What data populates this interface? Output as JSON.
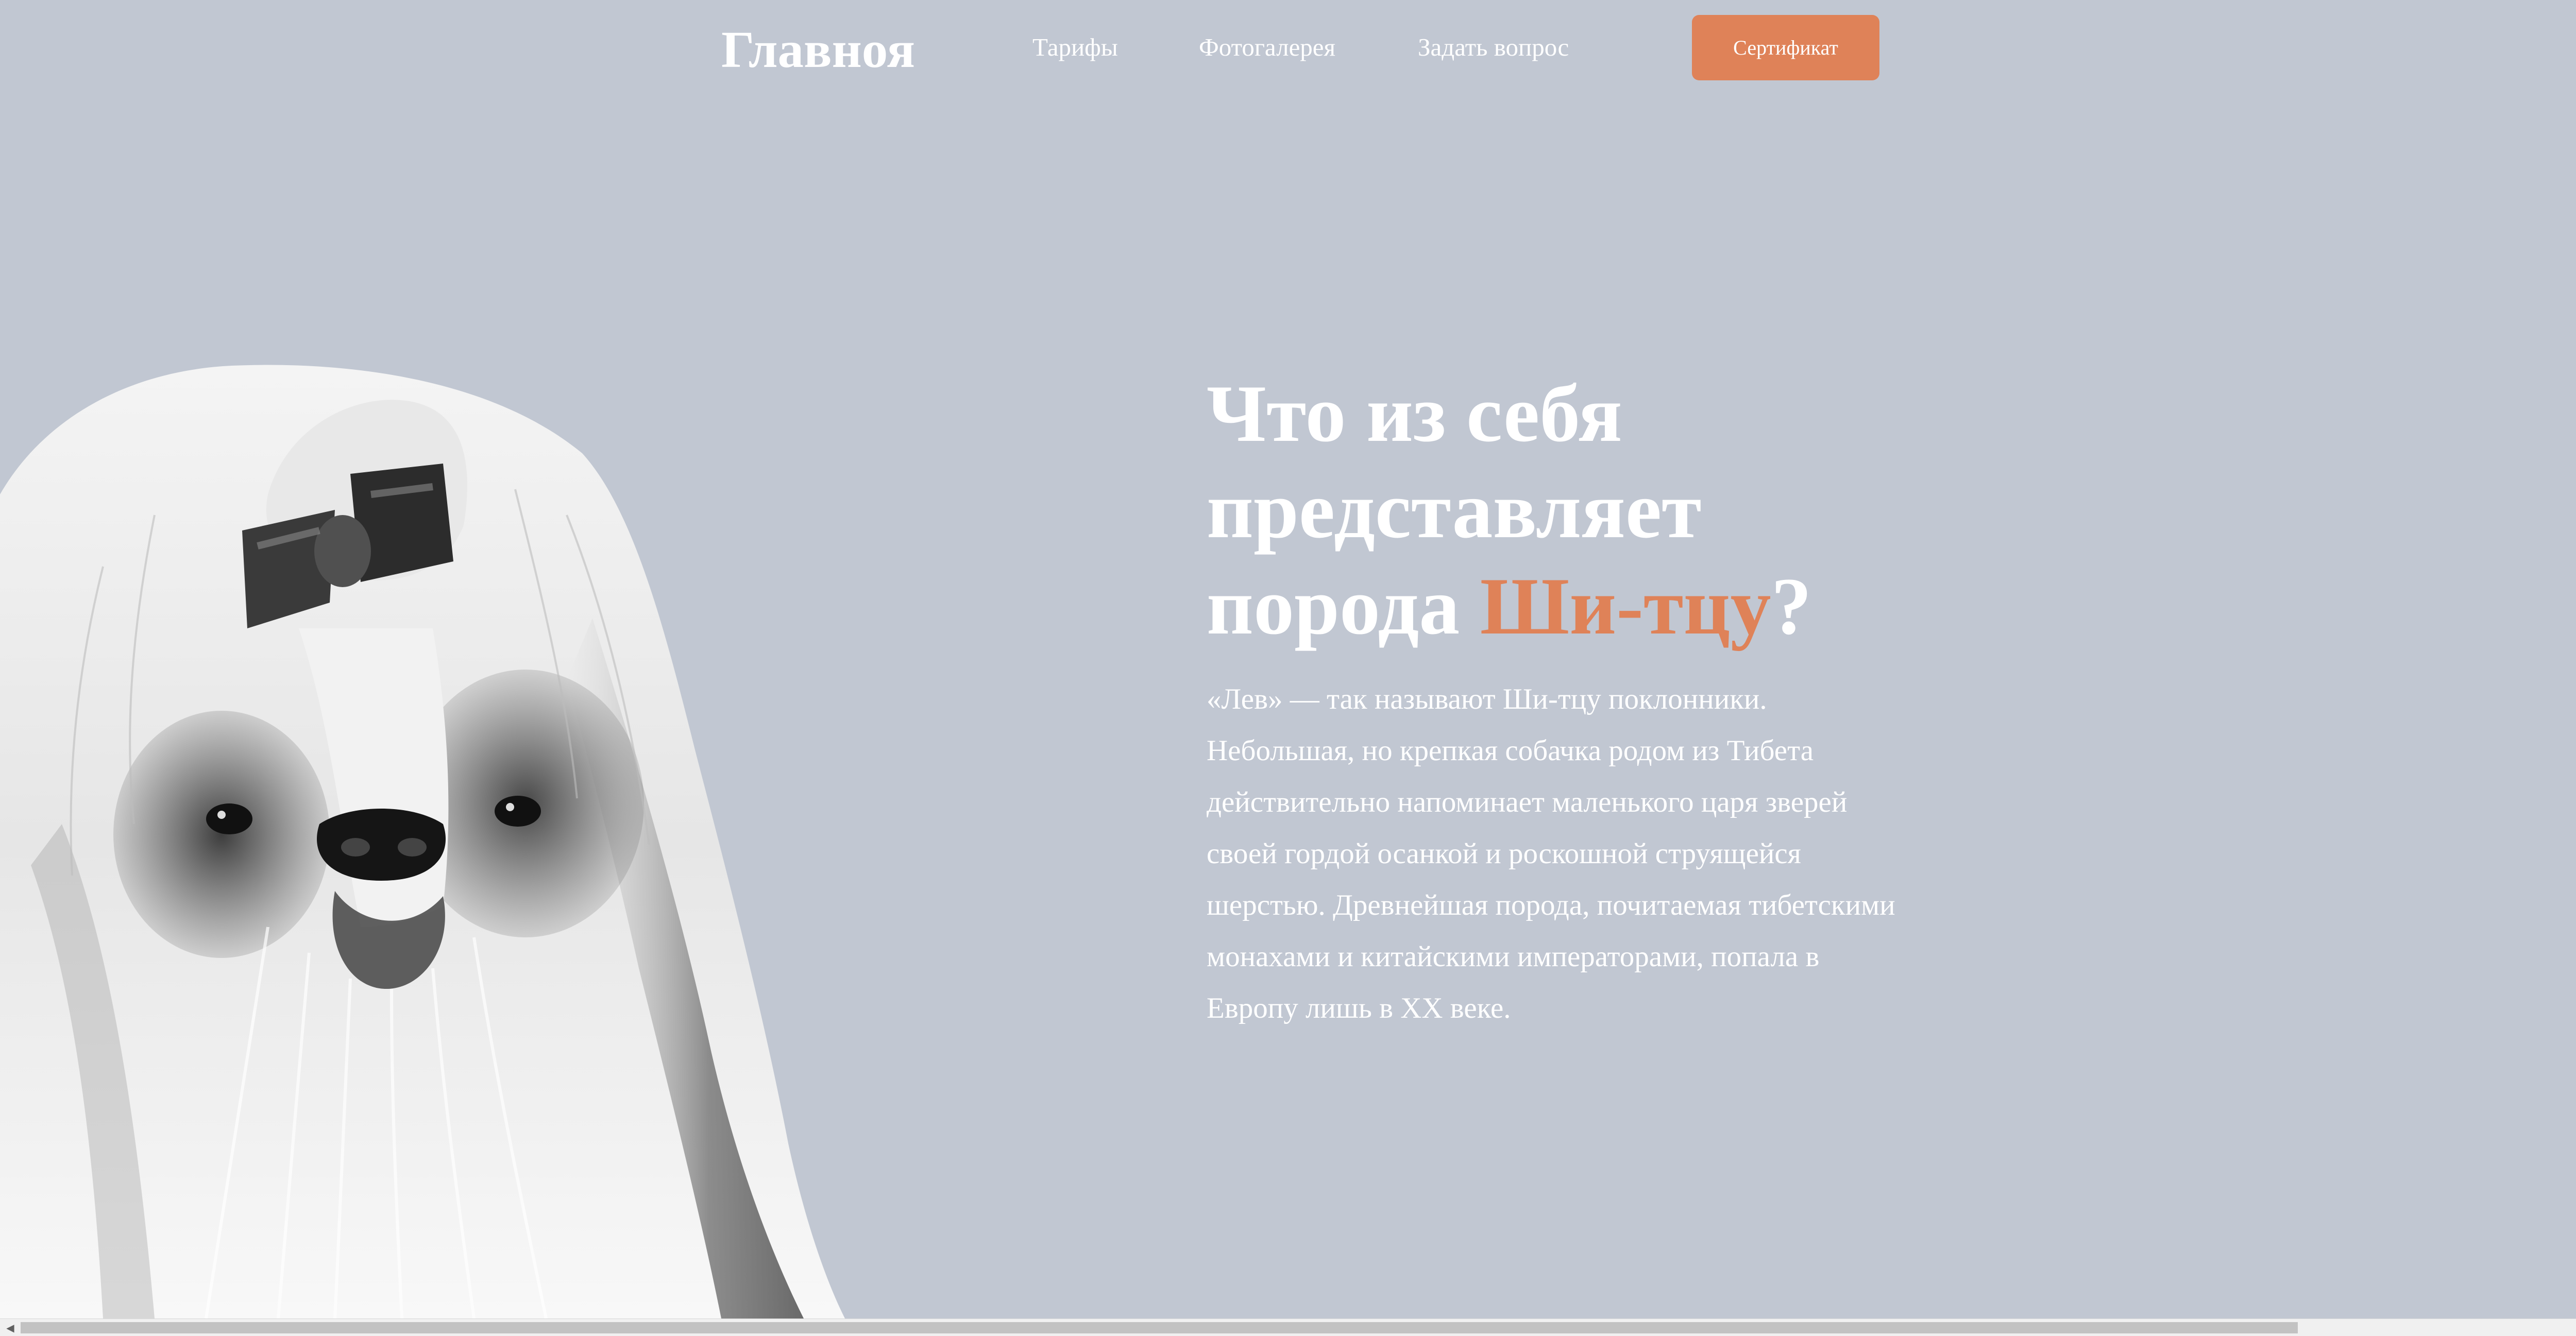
{
  "header": {
    "logo": "Главноя",
    "nav": [
      {
        "label": "Тарифы"
      },
      {
        "label": "Фотогалерея"
      },
      {
        "label": "Задать вопрос"
      }
    ],
    "cta_label": "Сертификат"
  },
  "hero": {
    "title_line1": "Что из себя",
    "title_line2": "представляет",
    "title_line3_prefix": "порода ",
    "title_accent": "Ши-тцу",
    "title_suffix": "?",
    "description": "«Лев» — так называют Ши-тцу поклонники. Небольшая, но крепкая собачка родом из Тибета действительно напоминает маленького царя зверей своей гордой осанкой и роскошной струящейся шерстью. Древнейшая порода, почитаемая тибетскими монахами и китайскими императорами, попала в Европу лишь в XX веке.",
    "image_icon": "shih-tzu-dog-photo"
  },
  "colors": {
    "background": "#c1c7d2",
    "accent": "#df8258",
    "text": "#ffffff"
  }
}
